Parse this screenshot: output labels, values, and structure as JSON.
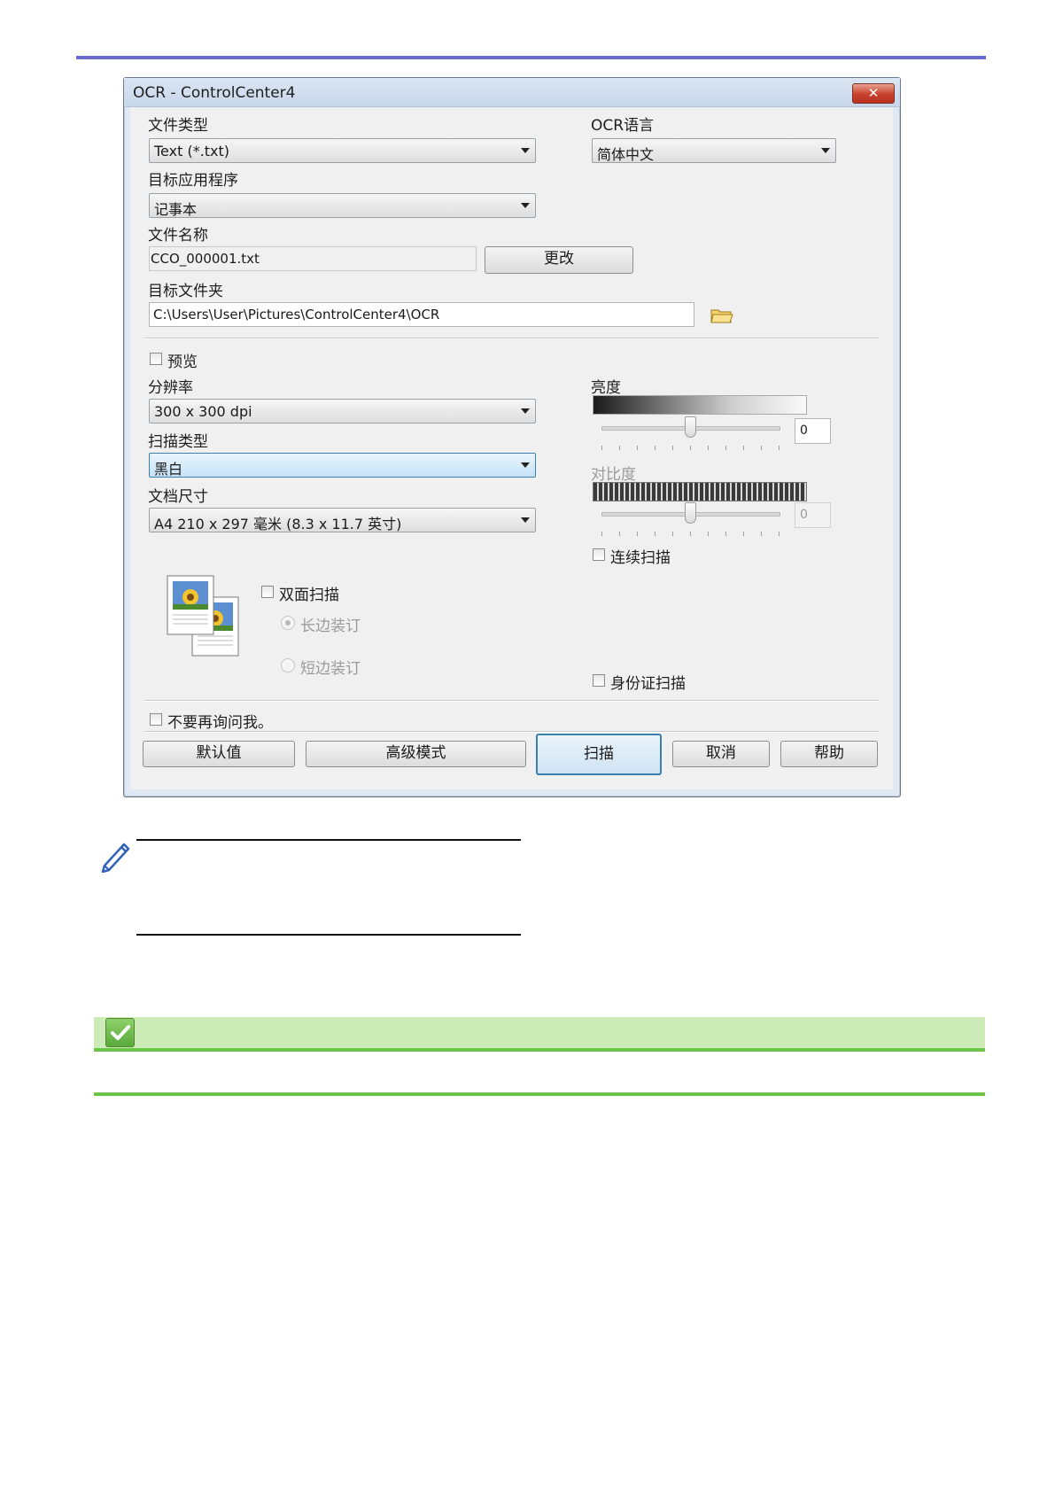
{
  "dialog": {
    "title": "OCR - ControlCenter4",
    "close_label": "✕"
  },
  "file_type": {
    "label": "文件类型",
    "value": "Text (*.txt)"
  },
  "ocr_language": {
    "label": "OCR语言",
    "value": "简体中文"
  },
  "target_app": {
    "label": "目标应用程序",
    "value": "记事本"
  },
  "file_name": {
    "label": "文件名称",
    "value": "CCO_000001.txt",
    "change_button": "更改"
  },
  "target_folder": {
    "label": "目标文件夹",
    "value": "C:\\Users\\User\\Pictures\\ControlCenter4\\OCR",
    "folder_icon": "folder-icon"
  },
  "preview": {
    "label": "预览",
    "checked": false
  },
  "resolution": {
    "label": "分辨率",
    "value": "300 x 300 dpi"
  },
  "scan_type": {
    "label": "扫描类型",
    "value": "黑白"
  },
  "document_size": {
    "label": "文档尺寸",
    "value": "A4 210 x 297 毫米 (8.3 x 11.7 英寸)"
  },
  "brightness": {
    "label": "亮度",
    "value": "0",
    "level": 0.5
  },
  "contrast": {
    "label": "对比度",
    "value": "0",
    "level": 0.5,
    "disabled": true
  },
  "continuous_scan": {
    "label": "连续扫描",
    "checked": false
  },
  "duplex": {
    "label": "双面扫描",
    "checked": false,
    "options": [
      {
        "label": "长边装订",
        "selected": true
      },
      {
        "label": "短边装订",
        "selected": false
      }
    ]
  },
  "id_card_scan": {
    "label": "身份证扫描",
    "checked": false
  },
  "dont_ask": {
    "label": "不要再询问我。",
    "checked": false
  },
  "buttons": {
    "default": "默认值",
    "advanced": "高级模式",
    "scan": "扫描",
    "cancel": "取消",
    "help": "帮助"
  },
  "colors": {
    "top_rule": "#6b6bd0",
    "related_band": "#cdebb6",
    "related_rule": "#6cc44a"
  }
}
